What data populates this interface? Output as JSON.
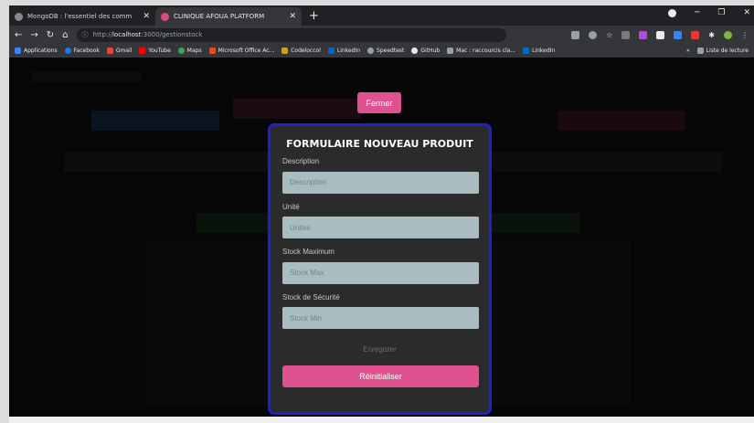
{
  "tabs": [
    {
      "title": "MongoDB : l'essentiel des comm",
      "active": false
    },
    {
      "title": "CLINIQUE AFOUA PLATFORM",
      "active": true
    }
  ],
  "address": {
    "scheme": "http://",
    "host": "localhost",
    "path": ":3000/gestionstock"
  },
  "bookmarks": [
    "Applications",
    "Facebook",
    "Gmail",
    "YouTube",
    "Maps",
    "Microsoft Office Ac...",
    "Codeloccol",
    "LinkedIn",
    "Speedtest",
    "GitHub",
    "Mac : raccourcis cla...",
    "LinkedIn"
  ],
  "bookmarks_more": "Liste de lecture",
  "close_button": "Fermer",
  "form": {
    "title": "FORMULAIRE NOUVEAU PRODUIT",
    "fields": [
      {
        "label": "Description",
        "placeholder": "Description"
      },
      {
        "label": "Unité",
        "placeholder": "Unites"
      },
      {
        "label": "Stock Maximum",
        "placeholder": "Stock Max"
      },
      {
        "label": "Stock de Sécurité",
        "placeholder": "Stock Min"
      }
    ],
    "save": "Enregister",
    "reset": "Réinitialiser"
  },
  "colors": {
    "accent": "#e0528f",
    "form_border": "#1f1fd6",
    "input_bg": "#a9bcc0"
  }
}
